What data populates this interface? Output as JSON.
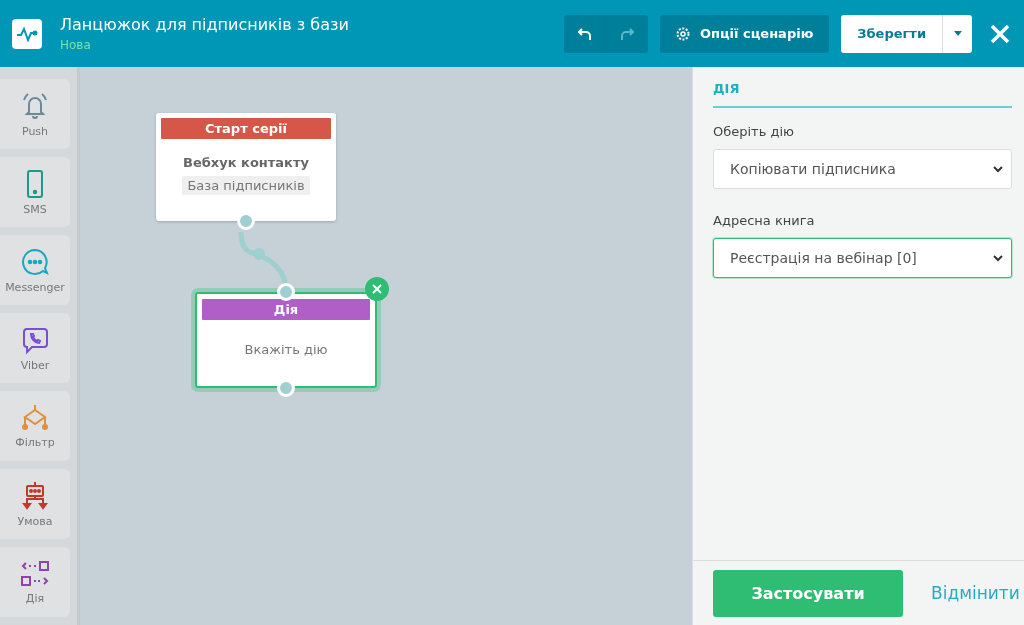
{
  "header": {
    "title": "Ланцюжок для підписників з бази",
    "status": "Нова",
    "options_button": "Опції сценарію",
    "save_button": "Зберегти"
  },
  "palette": [
    {
      "kind": "push",
      "label": "Push"
    },
    {
      "kind": "sms",
      "label": "SMS"
    },
    {
      "kind": "messenger",
      "label": "Messenger"
    },
    {
      "kind": "viber",
      "label": "Viber"
    },
    {
      "kind": "filter",
      "label": "Фільтр"
    },
    {
      "kind": "condition",
      "label": "Умова"
    },
    {
      "kind": "action",
      "label": "Дія"
    }
  ],
  "canvas": {
    "nodes": [
      {
        "kind": "start",
        "header": "Старт серії",
        "title": "Вебхук контакту",
        "tag": "База підписників",
        "selected": false
      },
      {
        "kind": "action",
        "header": "Дія",
        "hint": "Вкажіть дію",
        "selected": true
      }
    ]
  },
  "panel": {
    "heading": "ДІЯ",
    "fields": [
      {
        "label": "Оберіть дію",
        "value": "Копіювати підписника",
        "focused": false
      },
      {
        "label": "Адресна книга",
        "value": "Реєстрація на вебінар [0]",
        "focused": true
      }
    ],
    "apply_button": "Застосувати",
    "cancel_link": "Відмінити"
  }
}
